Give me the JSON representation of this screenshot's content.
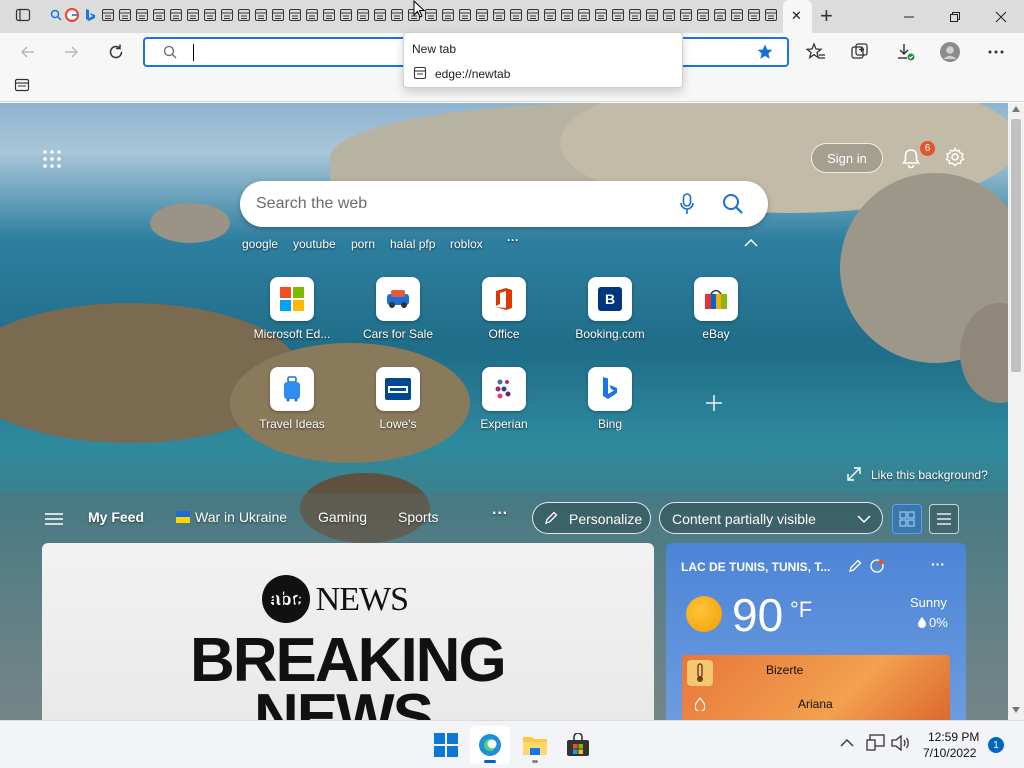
{
  "browser": {
    "dropdown": {
      "title": "New tab",
      "url": "edge://newtab"
    },
    "address_value": "",
    "tab_close_glyph": "✕",
    "new_tab_glyph": "+"
  },
  "newtab": {
    "search_placeholder": "Search the web",
    "sign_in": "Sign in",
    "notification_count": "6",
    "quick_links": [
      "google",
      "youtube",
      "porn",
      "halal pfp",
      "roblox"
    ],
    "more_glyph": "···",
    "shortcuts": [
      {
        "label": "Microsoft Ed...",
        "icon": "microsoft-icon"
      },
      {
        "label": "Cars for Sale",
        "icon": "car-icon"
      },
      {
        "label": "Office",
        "icon": "office-icon"
      },
      {
        "label": "Booking.com",
        "icon": "booking-icon"
      },
      {
        "label": "eBay",
        "icon": "ebay-icon"
      },
      {
        "label": "Travel Ideas",
        "icon": "luggage-icon"
      },
      {
        "label": "Lowe's",
        "icon": "lowes-icon"
      },
      {
        "label": "Experian",
        "icon": "experian-icon"
      },
      {
        "label": "Bing",
        "icon": "bing-icon"
      }
    ],
    "like_background": "Like this background?"
  },
  "feed": {
    "tabs": [
      "My Feed",
      "War in Ukraine",
      "Gaming",
      "Sports"
    ],
    "personalize": "Personalize",
    "content_visibility": "Content partially visible"
  },
  "news_card": {
    "brand": "abc NEWS",
    "headline_line1": "BREAKING",
    "headline_line2": "NEWS"
  },
  "weather": {
    "location": "LAC DE TUNIS, TUNIS, T...",
    "temperature": "90",
    "unit": "°F",
    "condition": "Sunny",
    "precip": "0%",
    "map_labels": [
      "Bizerte",
      "Ariana"
    ]
  },
  "taskbar": {
    "time": "12:59 PM",
    "date": "7/10/2022",
    "notification_badge": "1"
  },
  "colors": {
    "accent": "#1a73e8",
    "edge_blue": "#0c59a4",
    "badge_orange": "#e0552b"
  }
}
